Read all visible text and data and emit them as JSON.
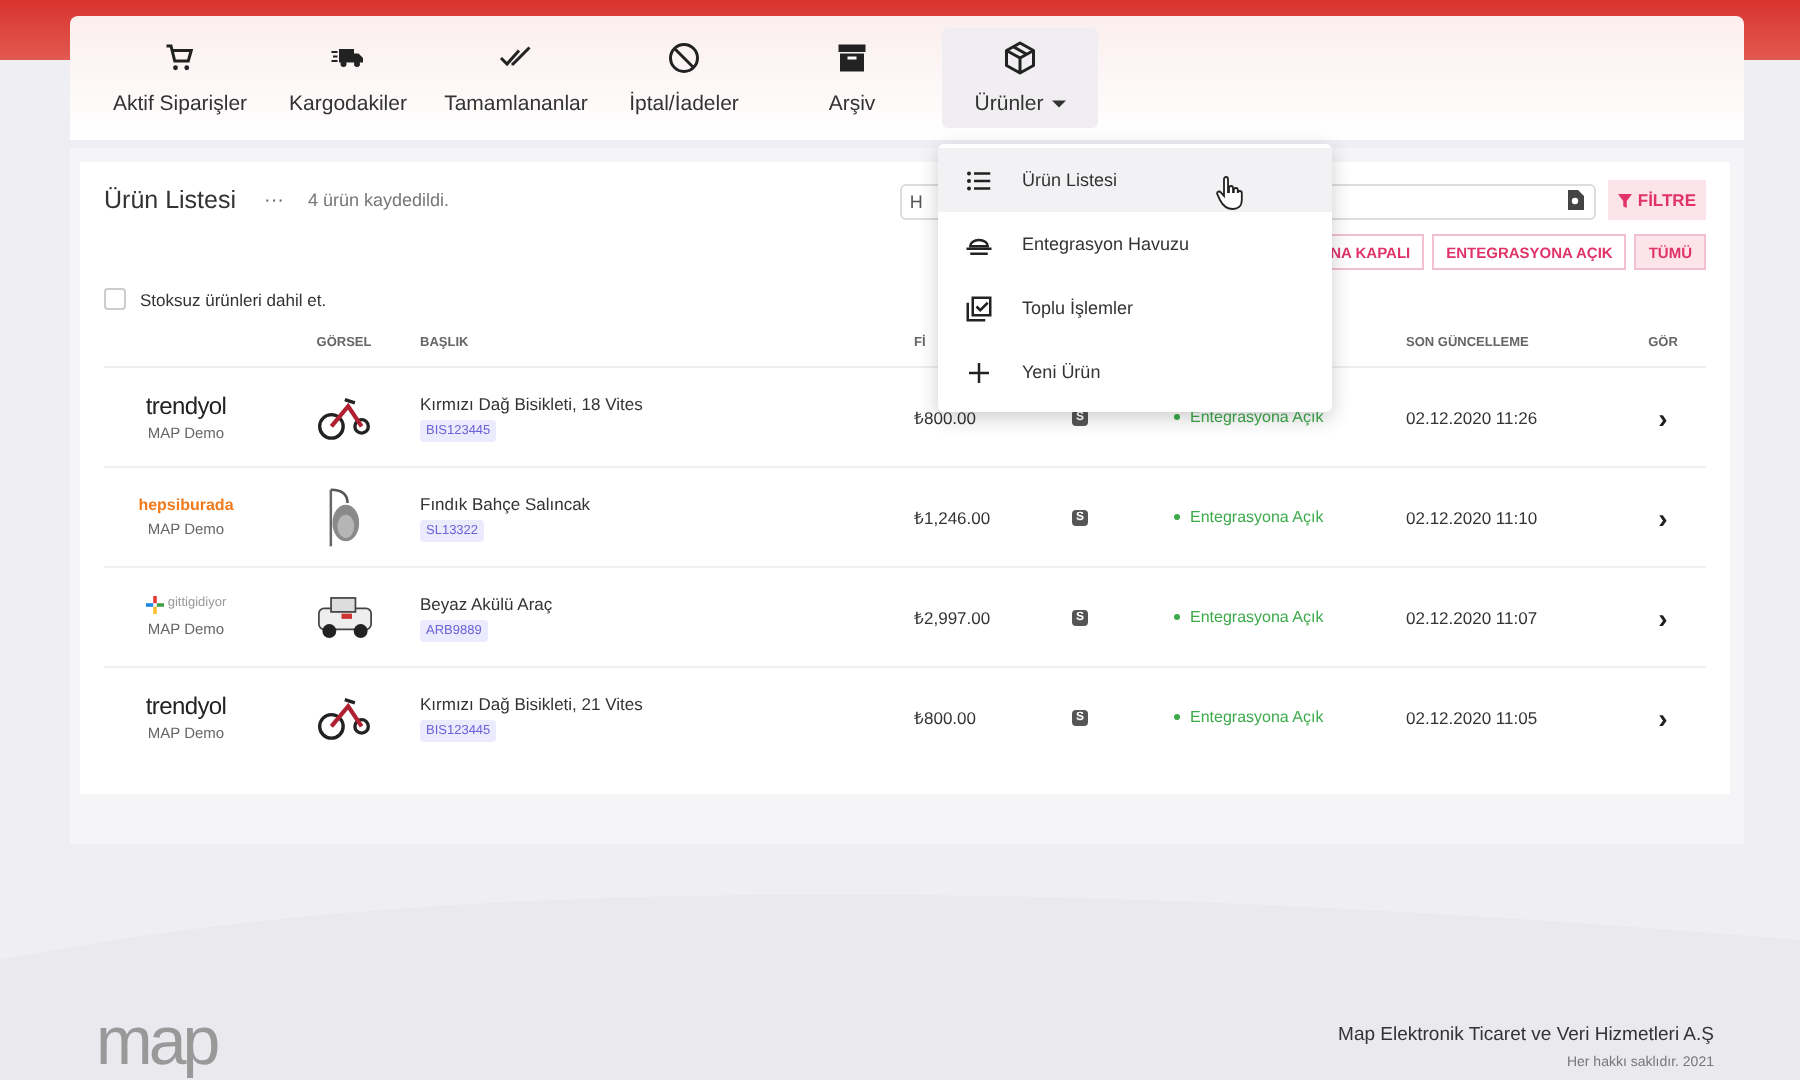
{
  "nav": [
    {
      "label": "Aktif Siparişler",
      "kind": "link",
      "selected": false
    },
    {
      "label": "Kargodakiler",
      "kind": "link",
      "selected": false
    },
    {
      "label": "Tamamlananlar",
      "kind": "link",
      "selected": false
    },
    {
      "label": "İptal/İadeler",
      "kind": "link",
      "selected": false
    },
    {
      "label": "Arşiv",
      "kind": "link",
      "selected": false
    },
    {
      "label": "Ürünler",
      "kind": "menu",
      "selected": true
    }
  ],
  "menu": [
    {
      "label": "Ürün Listesi",
      "selected": true
    },
    {
      "label": "Entegrasyon Havuzu",
      "selected": false
    },
    {
      "label": "Toplu İşlemler",
      "selected": false
    },
    {
      "label": "Yeni Ürün",
      "selected": false
    }
  ],
  "panel": {
    "title": "Ürün Listesi",
    "more": "···",
    "count": "4 ürün kaydedildi.",
    "search": {
      "placeholder": "H"
    },
    "filter_button": "FİLTRE",
    "filters": [
      {
        "label": "NA KAPALI",
        "selected": false
      },
      {
        "label": "ENTEGRASYONA AÇIK",
        "selected": false
      },
      {
        "label": "TÜMÜ",
        "selected": true
      }
    ],
    "stock_checkbox": {
      "label": "Stoksuz ürünleri dahil et.",
      "checked": false
    }
  },
  "table": {
    "columns": [
      "GÖRSEL",
      "BAŞLIK",
      "Fİ",
      "SON GÜNCELLEME",
      "GÖR"
    ],
    "rows": [
      {
        "store": {
          "kind": "trendyol",
          "logo": "trendyol"
        },
        "account": "MAP Demo",
        "title": "Kırmızı Dağ Bisikleti, 18 Vites",
        "sku": "BIS123445",
        "price": "₺800.00",
        "badge": "S",
        "status": "Entegrasyona Açık",
        "updated": "02.12.2020 11:26",
        "open": "›"
      },
      {
        "store": {
          "kind": "hepsiburada",
          "logo": "hepsiburada"
        },
        "account": "MAP Demo",
        "title": "Fındık Bahçe Salıncak",
        "sku": "SL13322",
        "price": "₺1,246.00",
        "badge": "S",
        "status": "Entegrasyona Açık",
        "updated": "02.12.2020 11:10",
        "open": "›"
      },
      {
        "store": {
          "kind": "gittigidiyor",
          "logo": "gittigidiyor"
        },
        "account": "MAP Demo",
        "title": "Beyaz Akülü Araç",
        "sku": "ARB9889",
        "price": "₺2,997.00",
        "badge": "S",
        "status": "Entegrasyona Açık",
        "updated": "02.12.2020 11:07",
        "open": "›"
      },
      {
        "store": {
          "kind": "trendyol",
          "logo": "trendyol"
        },
        "account": "MAP Demo",
        "title": "Kırmızı Dağ Bisikleti, 21 Vites",
        "sku": "BIS123445",
        "price": "₺800.00",
        "badge": "S",
        "status": "Entegrasyona Açık",
        "updated": "02.12.2020 11:05",
        "open": "›"
      }
    ]
  },
  "footer": {
    "logo": "map",
    "company": "Map Elektronik Ticaret ve Veri Hizmetleri A.Ş",
    "copyright": "Her hakkı saklıdır. 2021"
  }
}
